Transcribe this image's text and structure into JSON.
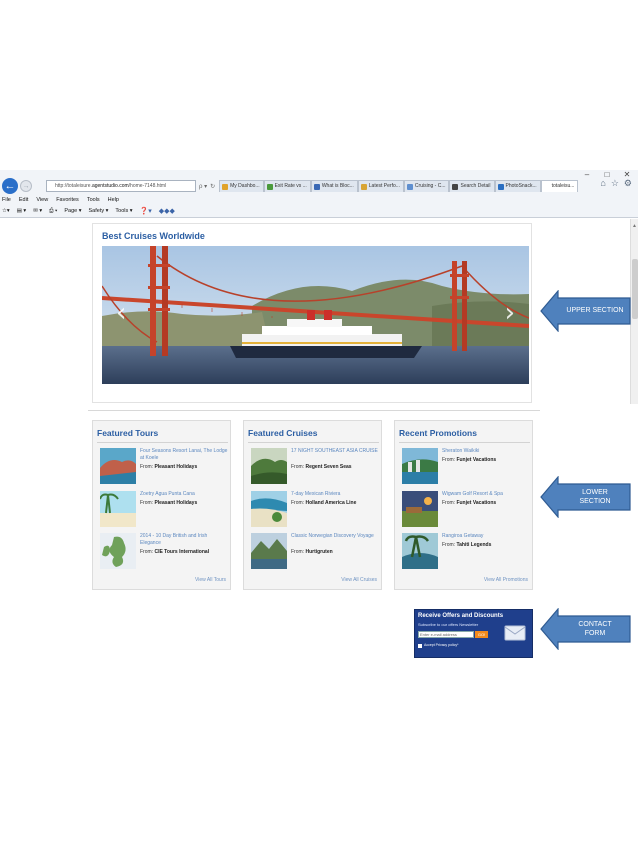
{
  "browser": {
    "window_controls": [
      "–",
      "□",
      "✕"
    ],
    "address": {
      "prefix": "http://totaleisure.",
      "host": "agentstudio.com",
      "path": "/home-7148.html"
    },
    "tabs": [
      {
        "label": "My Dashbo...",
        "color": "#e0a229"
      },
      {
        "label": "Exit Rate vs ...",
        "color": "#4a9a3c"
      },
      {
        "label": "What is Bloc...",
        "color": "#3a69b5"
      },
      {
        "label": "Latest Perfo...",
        "color": "#d8a534"
      },
      {
        "label": "Cruising - C...",
        "color": "#5f8fcf"
      },
      {
        "label": "Search Detail",
        "color": "#444"
      },
      {
        "label": "PhotoSnack...",
        "color": "#2b6fc2"
      },
      {
        "label": "totaleisu...",
        "color": "#ffffff"
      }
    ],
    "menu": [
      "File",
      "Edit",
      "View",
      "Favorites",
      "Tools",
      "Help"
    ],
    "commands": [
      "Page ▾",
      "Safety ▾",
      "Tools ▾"
    ]
  },
  "upper": {
    "title": "Best Cruises Worldwide",
    "prev": "‹",
    "next": "›"
  },
  "tours": {
    "title": "Featured Tours",
    "items": [
      {
        "title": "Four Seasons Resort Lanai, The Lodge at Koele",
        "from_label": "From:",
        "from": "Pleasant Holidays"
      },
      {
        "title": "Zoetry Agua Punta Cana",
        "from_label": "From:",
        "from": "Pleasant Holidays"
      },
      {
        "title": "2014 - 10 Day British and Irish Elegance",
        "from_label": "From:",
        "from": "CIE Tours International"
      }
    ],
    "view_all": "View All Tours"
  },
  "cruises": {
    "title": "Featured Cruises",
    "items": [
      {
        "title": "17 NIGHT SOUTHEAST ASIA CRUISE",
        "from_label": "From:",
        "from": "Regent Seven Seas"
      },
      {
        "title": "7-day Mexican Riviera",
        "from_label": "From:",
        "from": "Holland America Line"
      },
      {
        "title": "Classic Norwegian Discovery Voyage",
        "from_label": "From:",
        "from": "Hurtigruten"
      }
    ],
    "view_all": "View All Cruises"
  },
  "promos": {
    "title": "Recent Promotions",
    "items": [
      {
        "title": "Sheraton Waikiki",
        "from_label": "From:",
        "from": "Funjet Vacations"
      },
      {
        "title": "Wigwam Golf Resort & Spa",
        "from_label": "From:",
        "from": "Funjet Vacations"
      },
      {
        "title": "Rangiroa Getaway",
        "from_label": "From:",
        "from": "Tahiti Legends"
      }
    ],
    "view_all": "View All Promotions"
  },
  "newsletter": {
    "title": "Receive Offers and Discounts",
    "subtitle": "Subscribe to our offers Newsletter",
    "placeholder": "Enter e-mail address",
    "button": "GO!",
    "accept": "Accept Privacy policy*"
  },
  "callouts": {
    "upper": "UPPER SECTION",
    "lower_1": "LOWER",
    "lower_2": "SECTION",
    "contact_1": "CONTACT",
    "contact_2": "FORM"
  },
  "colors": {
    "title_blue": "#2b5ea3",
    "link_blue": "#5b87bf",
    "callout_blue": "#4f81bd",
    "newsletter_bg": "#1f3f8c",
    "go_orange": "#f28a1c"
  }
}
